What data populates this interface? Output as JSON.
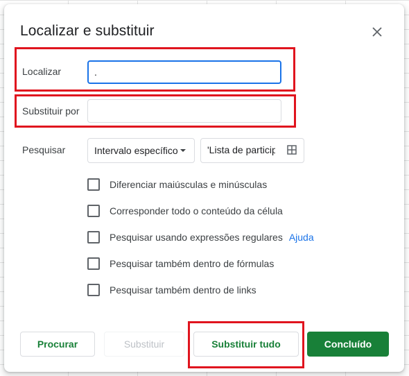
{
  "dialog": {
    "title": "Localizar e substituir",
    "close_icon": "close-icon"
  },
  "find": {
    "label": "Localizar",
    "value": "."
  },
  "replace": {
    "label": "Substituir por",
    "value": ""
  },
  "search": {
    "label": "Pesquisar",
    "scope_selected": "Intervalo específico",
    "range_value": "'Lista de particip",
    "range_icon": "grid-select-icon"
  },
  "options": [
    {
      "label": "Diferenciar maiúsculas e minúsculas",
      "checked": false
    },
    {
      "label": "Corresponder todo o conteúdo da célula",
      "checked": false
    },
    {
      "label": "Pesquisar usando expressões regulares",
      "checked": false,
      "link": "Ajuda"
    },
    {
      "label": "Pesquisar também dentro de fórmulas",
      "checked": false
    },
    {
      "label": "Pesquisar também dentro de links",
      "checked": false
    }
  ],
  "buttons": {
    "find": "Procurar",
    "replace": "Substituir",
    "replace_all": "Substituir tudo",
    "done": "Concluído"
  },
  "colors": {
    "accent_green": "#188038",
    "focus_blue": "#1a73e8",
    "highlight_red": "#e0141e"
  }
}
